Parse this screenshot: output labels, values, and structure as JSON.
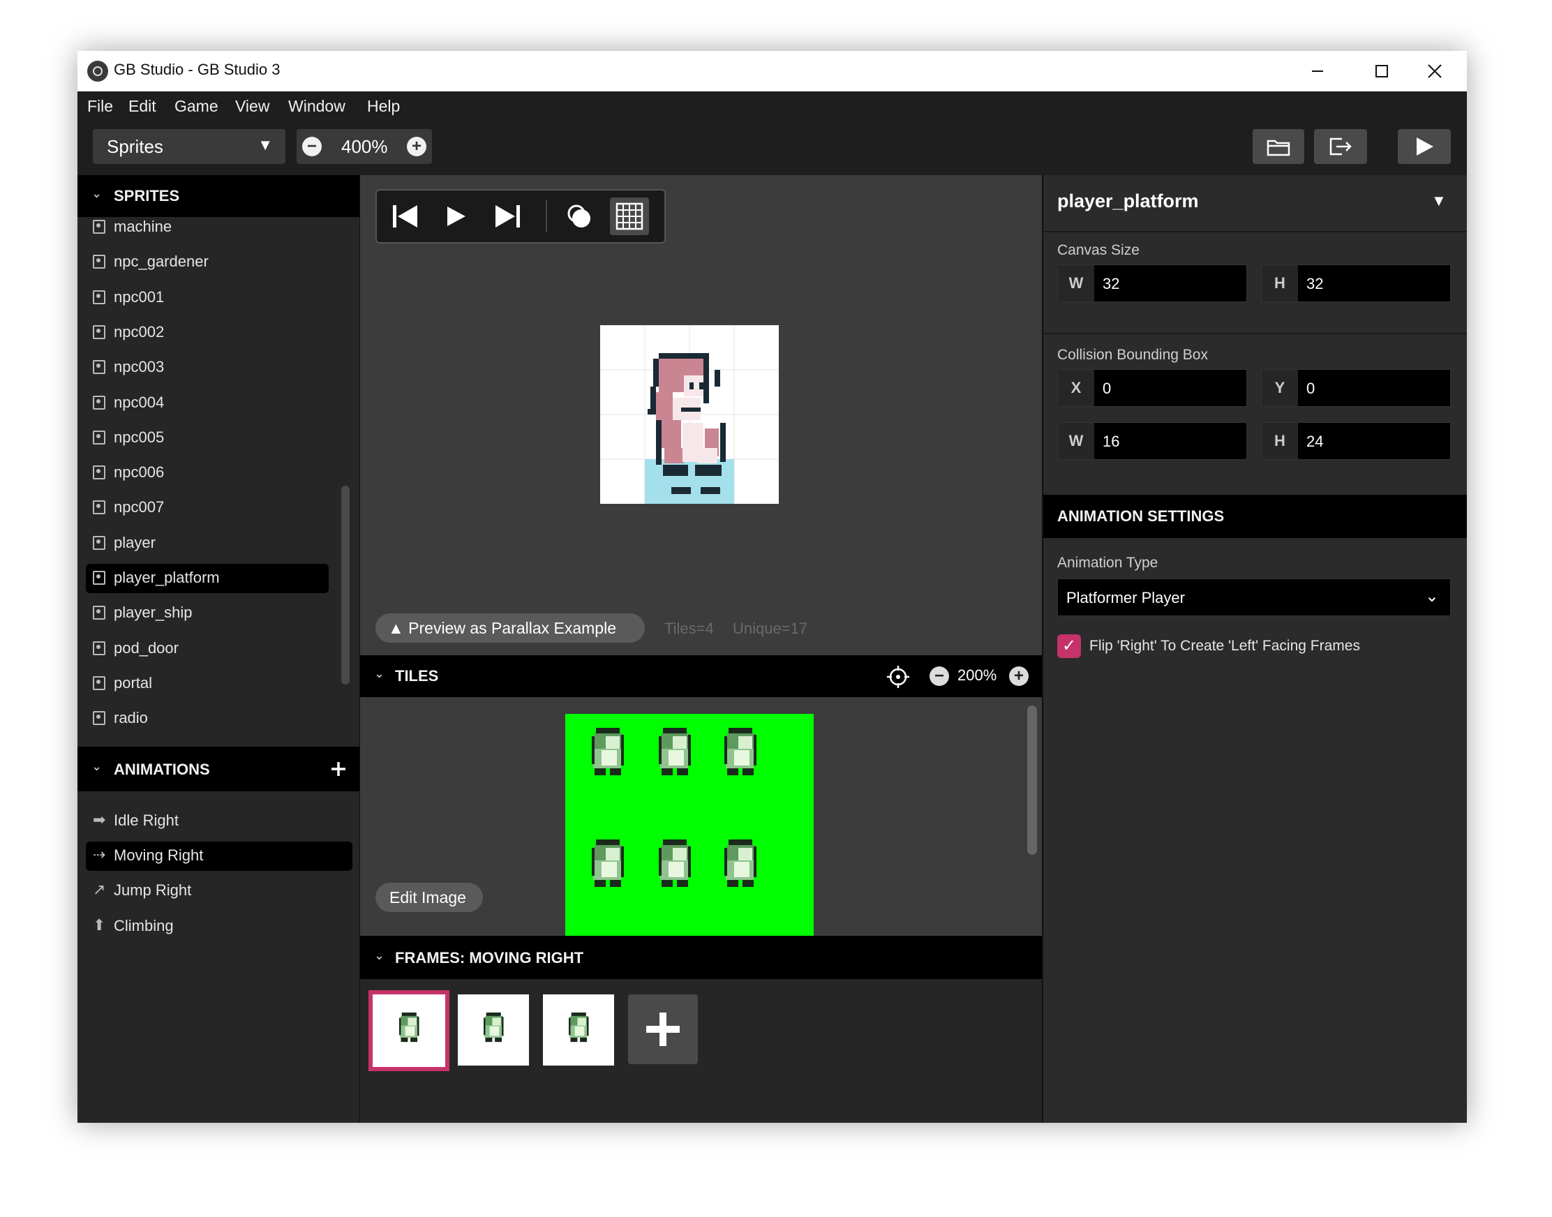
{
  "window": {
    "title": "GB Studio - GB Studio 3"
  },
  "menu": [
    "File",
    "Edit",
    "Game",
    "View",
    "Window",
    "Help"
  ],
  "toolbar": {
    "section": "Sprites",
    "zoom": "400%",
    "icons": [
      "folder-icon",
      "export-icon",
      "play-icon"
    ]
  },
  "sidebar": {
    "sprites_header": "SPRITES",
    "sprites": [
      "machine",
      "npc_gardener",
      "npc001",
      "npc002",
      "npc003",
      "npc004",
      "npc005",
      "npc006",
      "npc007",
      "player",
      "player_platform",
      "player_ship",
      "pod_door",
      "portal",
      "radio"
    ],
    "selected_sprite": "player_platform",
    "animations_header": "ANIMATIONS",
    "animations": [
      {
        "label": "Idle Right",
        "icon": "arrow-right-icon"
      },
      {
        "label": "Moving Right",
        "icon": "moving-right-icon"
      },
      {
        "label": "Jump Right",
        "icon": "jump-right-icon"
      },
      {
        "label": "Climbing",
        "icon": "arrow-up-icon"
      }
    ],
    "selected_animation": "Moving Right"
  },
  "center": {
    "parallax_button": "▲ Preview as Parallax Example",
    "tiles_count": "Tiles=4",
    "unique_count": "Unique=17",
    "tiles_header": "TILES",
    "tiles_zoom": "200%",
    "edit_image": "Edit Image",
    "frames_header": "FRAMES: MOVING RIGHT",
    "frame_count": 3,
    "selected_frame": 1,
    "tile_sheet_bg": "#00ff00",
    "accent": "#c6326a"
  },
  "right": {
    "sprite_name": "player_platform",
    "canvas_size_label": "Canvas Size",
    "canvas_w_label": "W",
    "canvas_w": "32",
    "canvas_h_label": "H",
    "canvas_h": "32",
    "collision_label": "Collision Bounding Box",
    "bbox_x_label": "X",
    "bbox_x": "0",
    "bbox_y_label": "Y",
    "bbox_y": "0",
    "bbox_w_label": "W",
    "bbox_w": "16",
    "bbox_h_label": "H",
    "bbox_h": "24",
    "animation_settings": "ANIMATION SETTINGS",
    "animation_type_label": "Animation Type",
    "animation_type": "Platformer Player",
    "flip_label": "Flip 'Right' To Create 'Left' Facing Frames",
    "flip_checked": true
  }
}
